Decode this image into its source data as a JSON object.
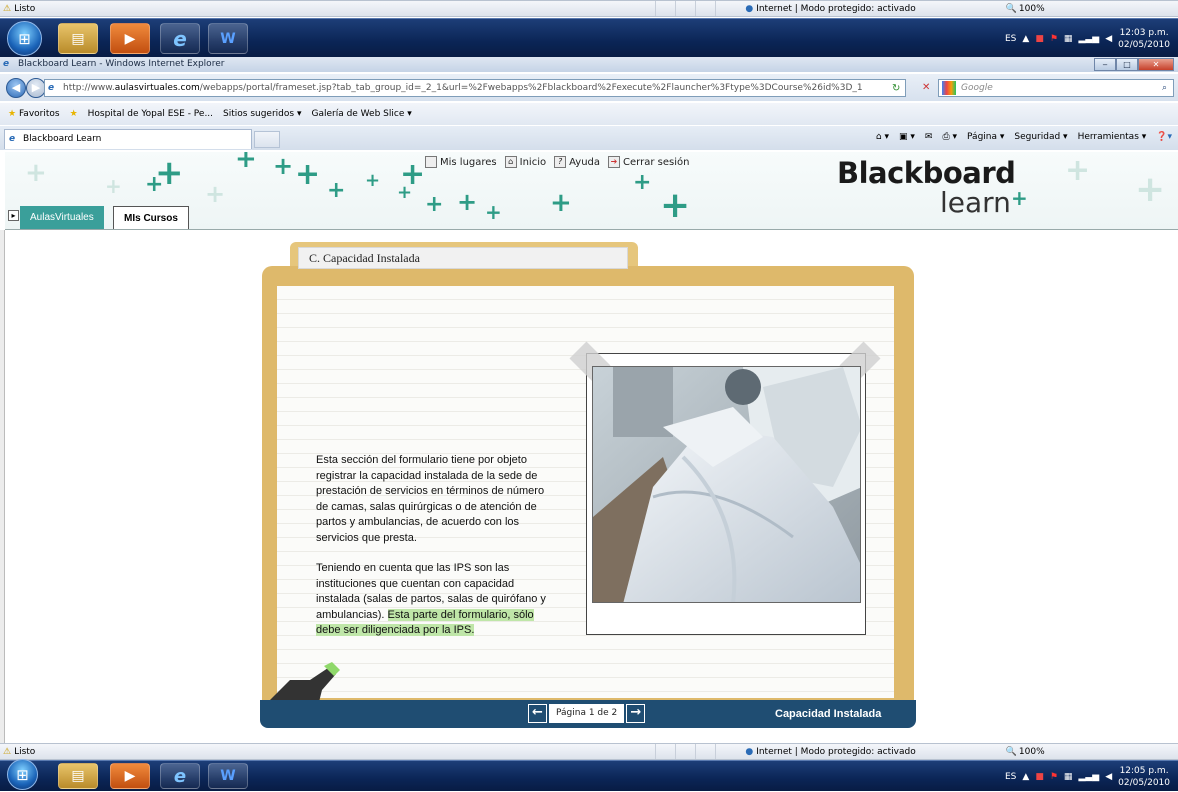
{
  "status": {
    "text": "Listo",
    "zone": "Internet | Modo protegido: activado",
    "zoom": "100%"
  },
  "taskbar": {
    "lang": "ES",
    "time_top": "12:03 p.m.",
    "time_bottom": "12:05 p.m.",
    "date": "02/05/2010"
  },
  "window": {
    "title": "Blackboard Learn - Windows Internet Explorer"
  },
  "address": {
    "url_prefix": "http://www.",
    "url_domain": "aulasvirtuales.com",
    "url_rest": "/webapps/portal/frameset.jsp?tab_tab_group_id=_2_1&url=%2Fwebapps%2Fblackboard%2Fexecute%2Flauncher%3Ftype%3DCourse%26id%3D_1",
    "search_placeholder": "Google"
  },
  "favorites": {
    "label": "Favoritos",
    "items": [
      "Hospital de Yopal ESE - Pe...",
      "Sitios sugeridos ▾",
      "Galería de Web Slice ▾"
    ]
  },
  "tab": {
    "title": "Blackboard Learn"
  },
  "commands": [
    "Página ▾",
    "Seguridad ▾",
    "Herramientas ▾"
  ],
  "bb": {
    "links": [
      "Mis lugares",
      "Inicio",
      "Ayuda",
      "Cerrar sesión"
    ],
    "logo_top": "Blackboard",
    "logo_bottom": "learn",
    "tabs": [
      "AulasVirtuales",
      "MIs Cursos"
    ]
  },
  "content": {
    "folder_title": "C. Capacidad Instalada",
    "para1": "Esta sección del formulario tiene por objeto registrar la capacidad instalada de la sede de prestación de servicios en términos de número de camas, salas quirúrgicas o de atención de partos y ambulancias, de acuerdo con los servicios que presta.",
    "para2": "Teniendo en cuenta que las IPS son las instituciones que cuentan con capacidad instalada (salas de partos, salas de quirófano y ambulancias).",
    "para2_highlight": "Esta parte del formulario, sólo debe ser diligenciada por la IPS.",
    "page_label": "Página 1 de 2",
    "section_title": "Capacidad Instalada"
  },
  "colors": {
    "teal": "#2e9c86",
    "folder": "#deb96b",
    "navy": "#1f4d72",
    "highlight": "#bfe6a8"
  }
}
